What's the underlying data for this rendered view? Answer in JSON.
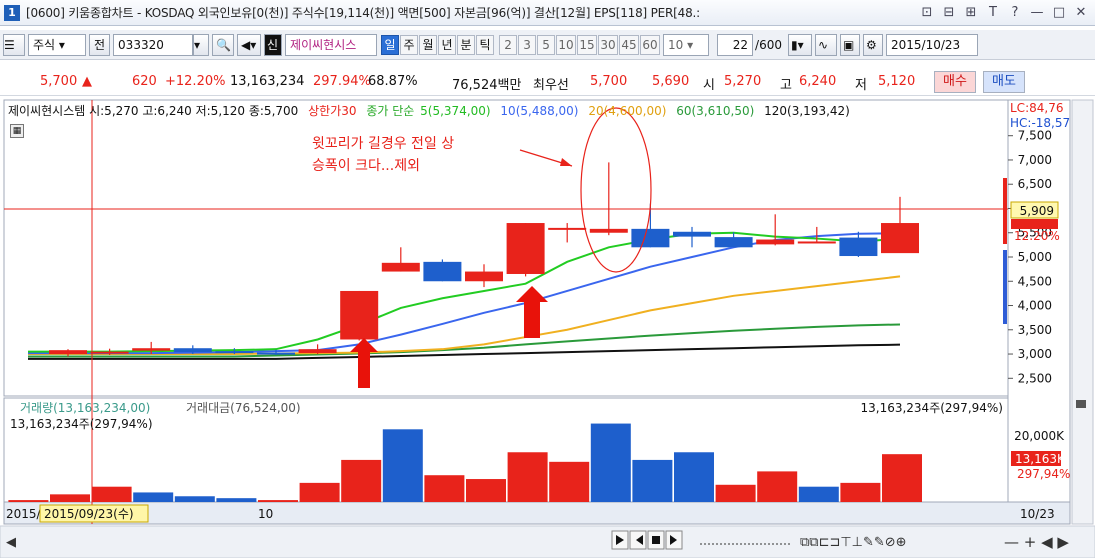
{
  "window": {
    "number": "1",
    "title": "[0600] 키움종합차트 - KOSDAQ 외국인보유[0(천)] 주식수[19,114(천)] 액면[500] 자본금[96(억)] 결산[12월] EPS[118] PER[48.:",
    "controls": [
      "⊡",
      "⊟",
      "⊞",
      "T",
      "?",
      "—",
      "□",
      "✕"
    ]
  },
  "toolbar": {
    "type_select": "주식",
    "all_label": "전",
    "code": "033320",
    "stock_name_tag": "신",
    "stock_name": "제이씨현시스",
    "periods": [
      "일",
      "주",
      "월",
      "년",
      "분",
      "틱"
    ],
    "active_period": "일",
    "minute_steps": [
      "2",
      "3",
      "5",
      "10",
      "15",
      "30",
      "45",
      "60"
    ],
    "count_select": "10",
    "page": "22",
    "page_total": "/600",
    "date": "2015/10/23"
  },
  "pricebar": {
    "price": "5,700",
    "arrow": "▲",
    "change": "620",
    "change_pct": "+12.20%",
    "volume": "13,163,234",
    "volume_ratio": "297.94%",
    "rotation": "68.87%",
    "amount": "76,524백만",
    "ask_label": "최우선",
    "ask": "5,700",
    "bid": "5,690",
    "open_label": "시",
    "open": "5,270",
    "high_label": "고",
    "high": "6,240",
    "low_label": "저",
    "low": "5,120",
    "buy_label": "매수",
    "sell_label": "매도"
  },
  "legend": {
    "title": "제이씨현시스템 시:5,270 고:6,240 저:5,120 종:5,700",
    "upper_limit": "상한가30",
    "ma_type": "종가 단순",
    "ma5": "5(5,374,00)",
    "ma10": "10(5,488,00)",
    "ma20": "20(4,600,00)",
    "ma60": "60(3,610,50)",
    "ma120": "120(3,193,42)",
    "lc": "LC:84,76",
    "hc": "HC:-18,57"
  },
  "annotation": {
    "line1": "윗꼬리가 길경우 전일 상",
    "line2": "승폭이 크다...제외"
  },
  "price_axis": {
    "ticks": [
      "7,500",
      "7,000",
      "6,500",
      "6,000",
      "5,500",
      "5,000",
      "4,500",
      "4,000",
      "3,500",
      "3,000",
      "2,500"
    ],
    "current_label": "5,909",
    "pct_label": "12.20%"
  },
  "volume_panel": {
    "legend_volume": "거래량(13,163,234,00)",
    "legend_amount": "거래대금(76,524,00)",
    "left_value": "13,163,234주(297,94%)",
    "right_value": "13,163,234주(297,94%)",
    "tick": "20,000K",
    "current_label": "13,163K",
    "pct_label": "297,94%"
  },
  "date_axis": {
    "year": "2015/",
    "cursor_date": "2015/09/23(수)",
    "month": "10",
    "right_date": "10/23"
  },
  "colors": {
    "up": "#e8231b",
    "down": "#1e5fcc",
    "ma5": "#22cc22",
    "ma10": "#3a66ee",
    "ma20": "#f0b020",
    "ma60": "#2a9a3a",
    "ma120": "#111111"
  },
  "chart_data": {
    "type": "candlestick",
    "ohlc": [
      {
        "o": 3000,
        "h": 3100,
        "l": 2950,
        "c": 3080
      },
      {
        "o": 3050,
        "h": 3110,
        "l": 2980,
        "c": 3050
      },
      {
        "o": 3070,
        "h": 3250,
        "l": 3000,
        "c": 3120
      },
      {
        "o": 3120,
        "h": 3180,
        "l": 3000,
        "c": 3040
      },
      {
        "o": 3060,
        "h": 3120,
        "l": 3000,
        "c": 3050
      },
      {
        "o": 3030,
        "h": 3090,
        "l": 2980,
        "c": 3000
      },
      {
        "o": 3020,
        "h": 3200,
        "l": 3000,
        "c": 3100
      },
      {
        "o": 3300,
        "h": 4300,
        "l": 3280,
        "c": 4300
      },
      {
        "o": 4700,
        "h": 5200,
        "l": 4700,
        "c": 4880
      },
      {
        "o": 4900,
        "h": 4950,
        "l": 4500,
        "c": 4500
      },
      {
        "o": 4500,
        "h": 4850,
        "l": 4380,
        "c": 4700
      },
      {
        "o": 4650,
        "h": 5700,
        "l": 4600,
        "c": 5700
      },
      {
        "o": 5600,
        "h": 5700,
        "l": 5300,
        "c": 5600
      },
      {
        "o": 5500,
        "h": 6950,
        "l": 5450,
        "c": 5580
      },
      {
        "o": 5580,
        "h": 6100,
        "l": 5200,
        "c": 5200
      },
      {
        "o": 5520,
        "h": 5620,
        "l": 5200,
        "c": 5420
      },
      {
        "o": 5410,
        "h": 5510,
        "l": 5200,
        "c": 5200
      },
      {
        "o": 5260,
        "h": 5880,
        "l": 5240,
        "c": 5360
      },
      {
        "o": 5320,
        "h": 5620,
        "l": 5300,
        "c": 5320
      },
      {
        "o": 5400,
        "h": 5520,
        "l": 5000,
        "c": 5020
      },
      {
        "o": 5080,
        "h": 6240,
        "l": 5120,
        "c": 5700
      }
    ],
    "volume": [
      100,
      400,
      800,
      500,
      300,
      200,
      100,
      1000,
      2200,
      3800,
      1400,
      1200,
      2600,
      2100,
      4100,
      2200,
      2600,
      900,
      1600,
      800,
      1000,
      2500
    ],
    "ma5": [
      3050,
      3060,
      3070,
      3080,
      3100,
      3300,
      3600,
      3950,
      4150,
      4300,
      4450,
      4900,
      5200,
      5360,
      5480,
      5500,
      5420,
      5380,
      5320,
      5374
    ],
    "ma10": [
      3020,
      3030,
      3040,
      3060,
      3080,
      3200,
      3400,
      3620,
      3850,
      4050,
      4300,
      4550,
      4800,
      5000,
      5200,
      5350,
      5430,
      5480,
      5488
    ],
    "ma20": [
      3000,
      3010,
      3020,
      3030,
      3060,
      3100,
      3200,
      3350,
      3500,
      3700,
      3900,
      4050,
      4200,
      4300,
      4400,
      4500,
      4600
    ],
    "ma60": [
      2950,
      2970,
      2990,
      3010,
      3040,
      3080,
      3130,
      3200,
      3260,
      3320,
      3380,
      3430,
      3480,
      3520,
      3560,
      3590,
      3610
    ],
    "ma120": [
      2900,
      2920,
      2940,
      2960,
      2980,
      3000,
      3020,
      3040,
      3060,
      3080,
      3100,
      3120,
      3140,
      3160,
      3180,
      3193
    ],
    "ylim": [
      2300,
      7700
    ]
  }
}
